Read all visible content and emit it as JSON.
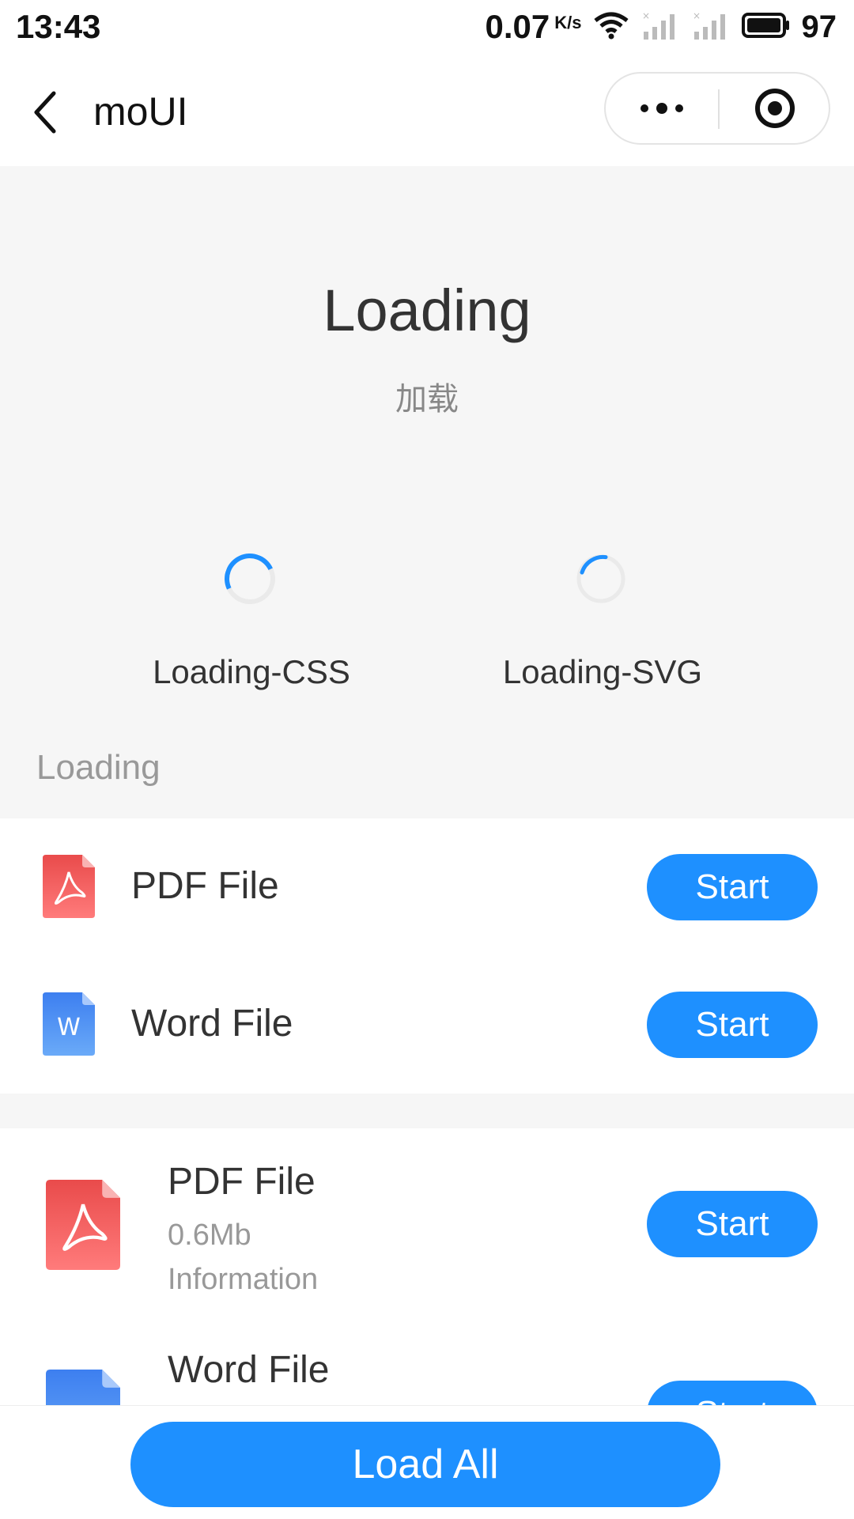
{
  "status_bar": {
    "time": "13:43",
    "speed": "0.07",
    "speed_unit": "K/s",
    "battery": "97"
  },
  "nav": {
    "title": "moUI",
    "icons": [
      "back-chevron-icon",
      "more-dots-icon",
      "capsule-close-icon"
    ]
  },
  "header": {
    "title": "Loading",
    "subtitle": "加载"
  },
  "demos": [
    {
      "label": "Loading-CSS"
    },
    {
      "label": "Loading-SVG"
    }
  ],
  "section": {
    "label": "Loading"
  },
  "list_simple": [
    {
      "title": "PDF File",
      "icon": "pdf-file-icon",
      "button": "Start"
    },
    {
      "title": "Word File",
      "icon": "word-file-icon",
      "button": "Start"
    }
  ],
  "list_detail": [
    {
      "title": "PDF File",
      "size": "0.6Mb",
      "info": "Information",
      "icon": "pdf-file-icon",
      "button": "Start"
    },
    {
      "title": "Word File",
      "icon": "word-file-icon",
      "button": "Start"
    }
  ],
  "bottom": {
    "button": "Load All"
  },
  "colors": {
    "accent": "#1e90ff",
    "pdf": "#f05a5a",
    "word": "#4a8ef0",
    "background": "#f6f6f6"
  }
}
